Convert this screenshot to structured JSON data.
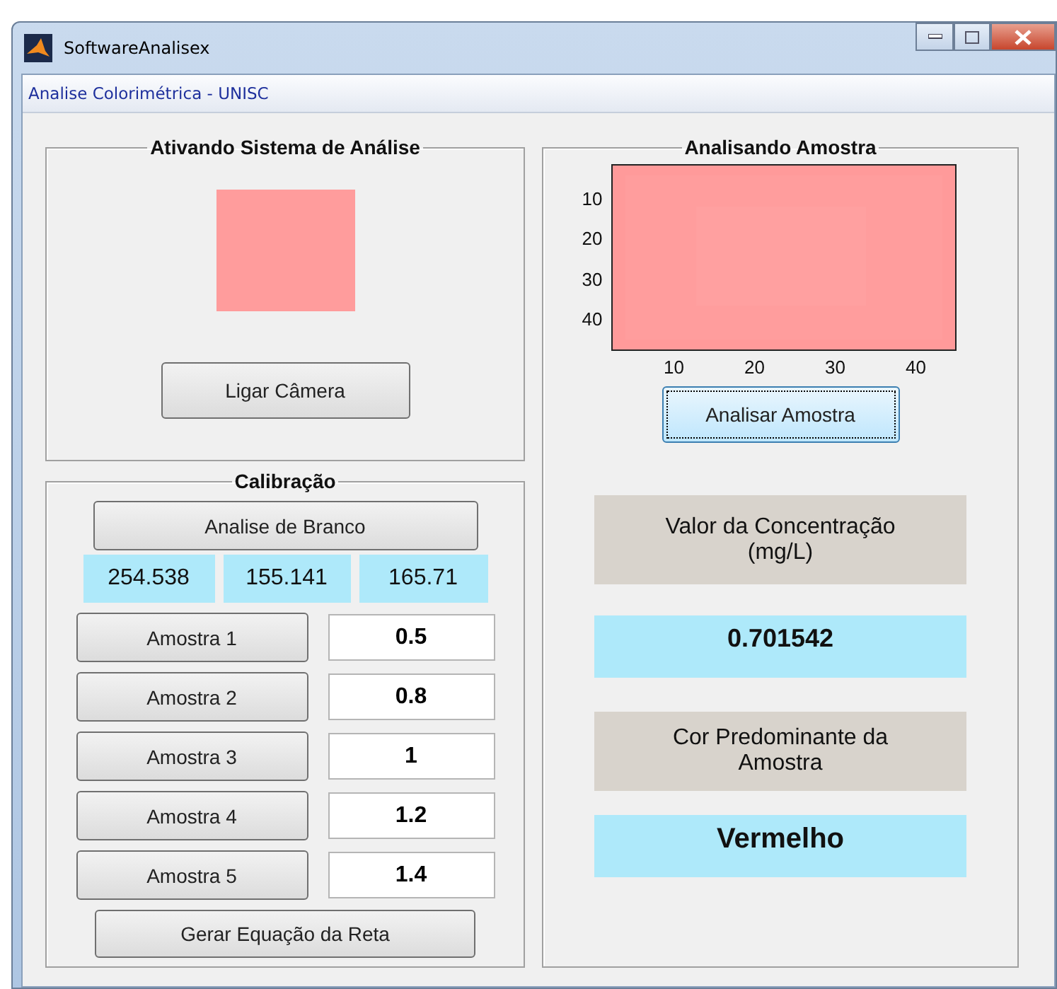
{
  "window": {
    "title": "SoftwareAnalisex"
  },
  "toolbar": {
    "title": "Analise Colorimétrica - UNISC"
  },
  "camera_panel": {
    "title": "Ativando Sistema de Análise",
    "button": "Ligar Câmera"
  },
  "calibration_panel": {
    "title": "Calibração",
    "blank_button": "Analise de Branco",
    "blank_values": [
      "254.538",
      "155.141",
      "165.71"
    ],
    "samples": [
      {
        "label": "Amostra 1",
        "value": "0.5"
      },
      {
        "label": "Amostra 2",
        "value": "0.8"
      },
      {
        "label": "Amostra 3",
        "value": "1"
      },
      {
        "label": "Amostra 4",
        "value": "1.2"
      },
      {
        "label": "Amostra 5",
        "value": "1.4"
      }
    ],
    "equation_button": "Gerar Equação da Reta"
  },
  "analysis_panel": {
    "title": "Analisando Amostra",
    "image_axes": {
      "xticks": [
        "10",
        "20",
        "30",
        "40"
      ],
      "yticks": [
        "10",
        "20",
        "30",
        "40"
      ]
    },
    "analyze_button": "Analisar Amostra",
    "concentration_label": "Valor da Concentração (mg/L)",
    "concentration_value": "0.701542",
    "color_label": "Cor Predominante da Amostra",
    "color_value": "Vermelho"
  }
}
